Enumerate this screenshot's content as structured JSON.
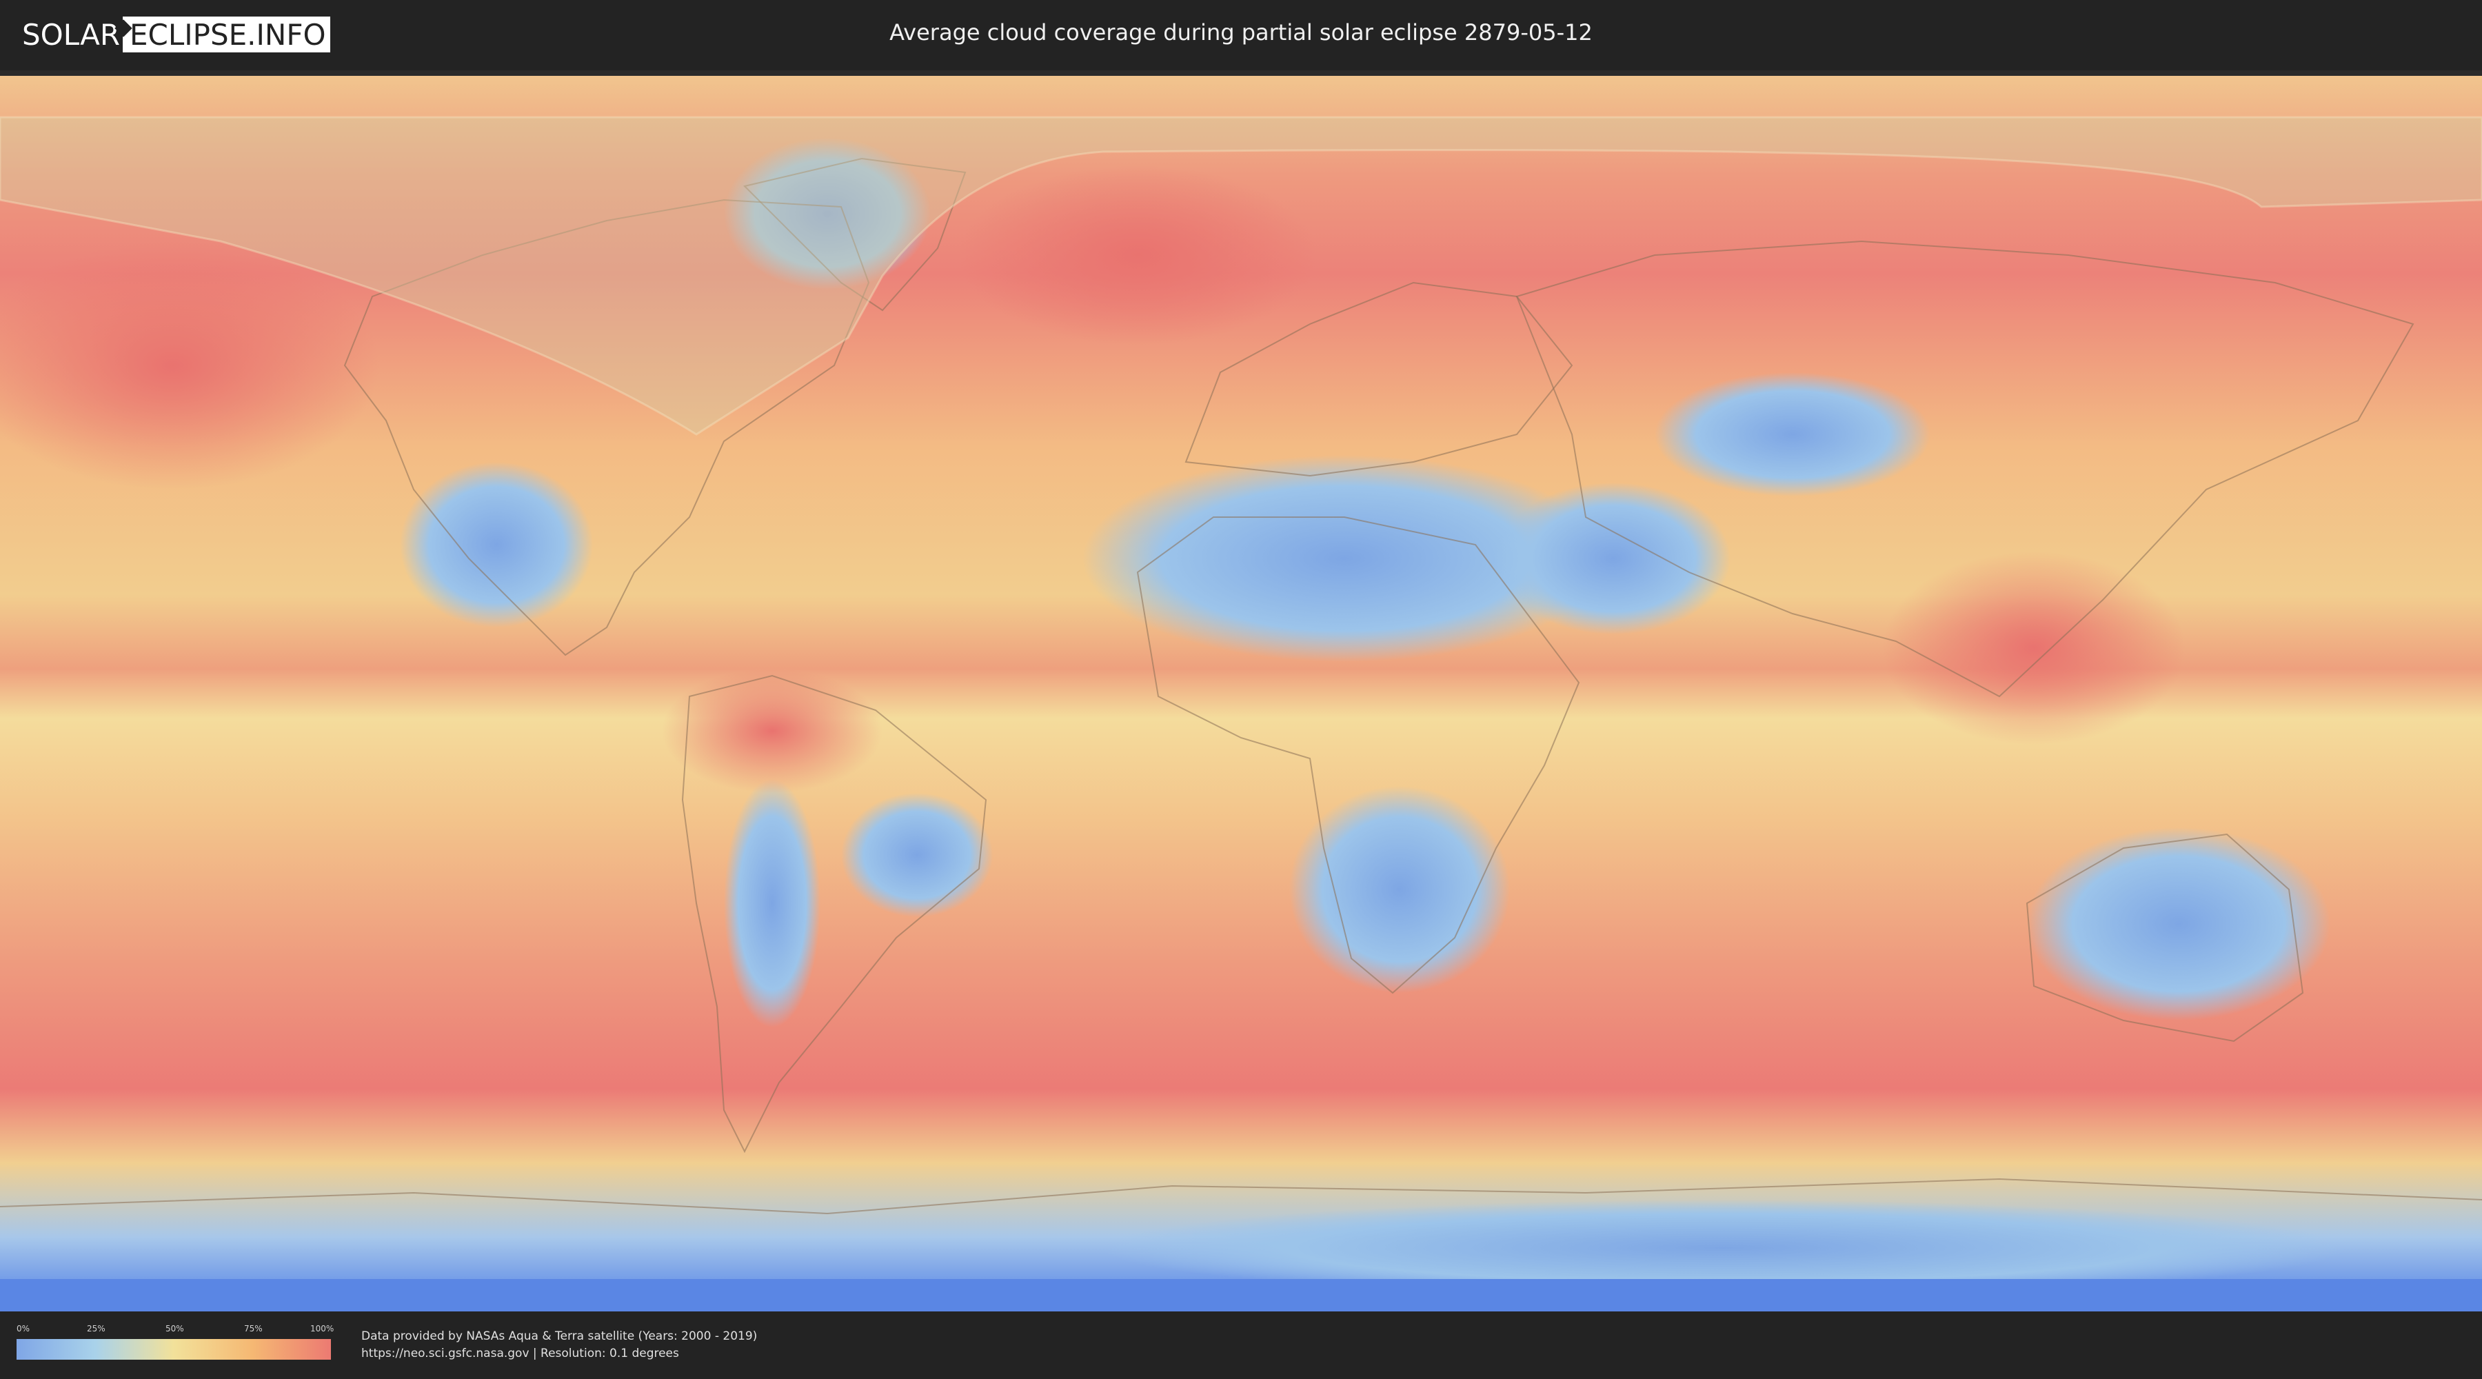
{
  "header": {
    "logo_left": "SOLAR",
    "logo_right": "ECLIPSE.INFO",
    "title": "Average cloud coverage during partial solar eclipse 2879-05-12"
  },
  "map": {
    "type": "equirectangular world cloud coverage map",
    "color_scale": [
      "#7fa6e6",
      "#a9d2ea",
      "#f2e19a",
      "#f5b873",
      "#ec7a72"
    ]
  },
  "legend": {
    "ticks": [
      "0%",
      "25%",
      "50%",
      "75%",
      "100%"
    ]
  },
  "credits": {
    "line1": "Data provided by NASAs Aqua & Terra satellite (Years: 2000 - 2019)",
    "line2": "https://neo.sci.gsfc.nasa.gov | Resolution: 0.1 degrees"
  }
}
